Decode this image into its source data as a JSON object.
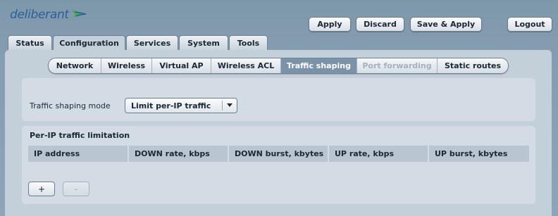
{
  "brand": {
    "name": "deliberant",
    "color": "#2c5f9a",
    "accent": "#3fae49",
    "icon": "swoosh-logo-icon"
  },
  "header": {
    "apply": "Apply",
    "discard": "Discard",
    "save_apply": "Save & Apply",
    "logout": "Logout"
  },
  "tabs": [
    {
      "label": "Status",
      "active": false
    },
    {
      "label": "Configuration",
      "active": true
    },
    {
      "label": "Services",
      "active": false
    },
    {
      "label": "System",
      "active": false
    },
    {
      "label": "Tools",
      "active": false
    }
  ],
  "subtabs": [
    {
      "label": "Network",
      "state": "normal"
    },
    {
      "label": "Wireless",
      "state": "normal"
    },
    {
      "label": "Virtual AP",
      "state": "normal"
    },
    {
      "label": "Wireless ACL",
      "state": "normal"
    },
    {
      "label": "Traffic shaping",
      "state": "active"
    },
    {
      "label": "Port forwarding",
      "state": "disabled"
    },
    {
      "label": "Static routes",
      "state": "normal"
    }
  ],
  "mode": {
    "label": "Traffic shaping mode",
    "value": "Limit per-IP traffic",
    "icon": "dropdown-arrow-icon"
  },
  "limits": {
    "title": "Per-IP traffic limitation",
    "columns": [
      "IP address",
      "DOWN rate, kbps",
      "DOWN burst, kbytes",
      "UP rate, kbps",
      "UP burst, kbytes"
    ],
    "rows": [],
    "add_label": "+",
    "remove_label": "-"
  }
}
